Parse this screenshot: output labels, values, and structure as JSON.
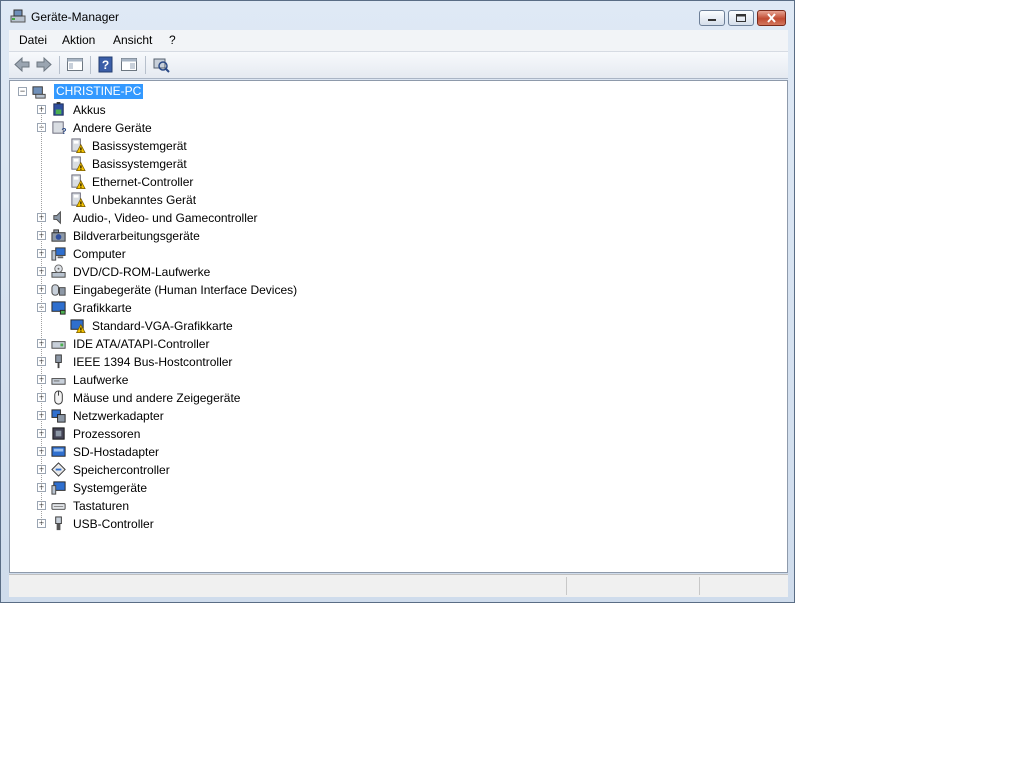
{
  "window": {
    "title": "Geräte-Manager"
  },
  "menu": [
    "Datei",
    "Aktion",
    "Ansicht",
    "?"
  ],
  "toolbar": [
    "back-icon",
    "forward-icon",
    "show-hide-console-tree-icon",
    "help-icon",
    "properties-icon",
    "scan-hardware-icon"
  ],
  "tree": {
    "root": "CHRISTINE-PC",
    "nodes": [
      {
        "label": "Akkus",
        "icon": "battery-icon",
        "expanded": false
      },
      {
        "label": "Andere Geräte",
        "icon": "unknown-device-icon",
        "expanded": true,
        "children": [
          "Basissystemgerät",
          "Basissystemgerät",
          "Ethernet-Controller",
          "Unbekanntes Gerät"
        ]
      },
      {
        "label": "Audio-, Video- und Gamecontroller",
        "icon": "speaker-icon",
        "expanded": false
      },
      {
        "label": "Bildverarbeitungsgeräte",
        "icon": "camera-icon",
        "expanded": false
      },
      {
        "label": "Computer",
        "icon": "computer-icon",
        "expanded": false
      },
      {
        "label": "DVD/CD-ROM-Laufwerke",
        "icon": "dvd-drive-icon",
        "expanded": false
      },
      {
        "label": "Eingabegeräte (Human Interface Devices)",
        "icon": "hid-icon",
        "expanded": false
      },
      {
        "label": "Grafikkarte",
        "icon": "display-adapter-icon",
        "expanded": true,
        "children": [
          "Standard-VGA-Grafikkarte"
        ]
      },
      {
        "label": "IDE ATA/ATAPI-Controller",
        "icon": "ide-controller-icon",
        "expanded": false
      },
      {
        "label": "IEEE 1394 Bus-Hostcontroller",
        "icon": "firewire-icon",
        "expanded": false
      },
      {
        "label": "Laufwerke",
        "icon": "disk-drive-icon",
        "expanded": false
      },
      {
        "label": "Mäuse und andere Zeigegeräte",
        "icon": "mouse-icon",
        "expanded": false
      },
      {
        "label": "Netzwerkadapter",
        "icon": "network-adapter-icon",
        "expanded": false
      },
      {
        "label": "Prozessoren",
        "icon": "processor-icon",
        "expanded": false
      },
      {
        "label": "SD-Hostadapter",
        "icon": "sd-card-icon",
        "expanded": false
      },
      {
        "label": "Speichercontroller",
        "icon": "storage-controller-icon",
        "expanded": false
      },
      {
        "label": "Systemgeräte",
        "icon": "system-devices-icon",
        "expanded": false
      },
      {
        "label": "Tastaturen",
        "icon": "keyboard-icon",
        "expanded": false
      },
      {
        "label": "USB-Controller",
        "icon": "usb-icon",
        "expanded": false
      }
    ]
  },
  "colors": {
    "selection": "#3399ff",
    "warning": "#f5c400",
    "titlebar": "#dfe9f5"
  }
}
